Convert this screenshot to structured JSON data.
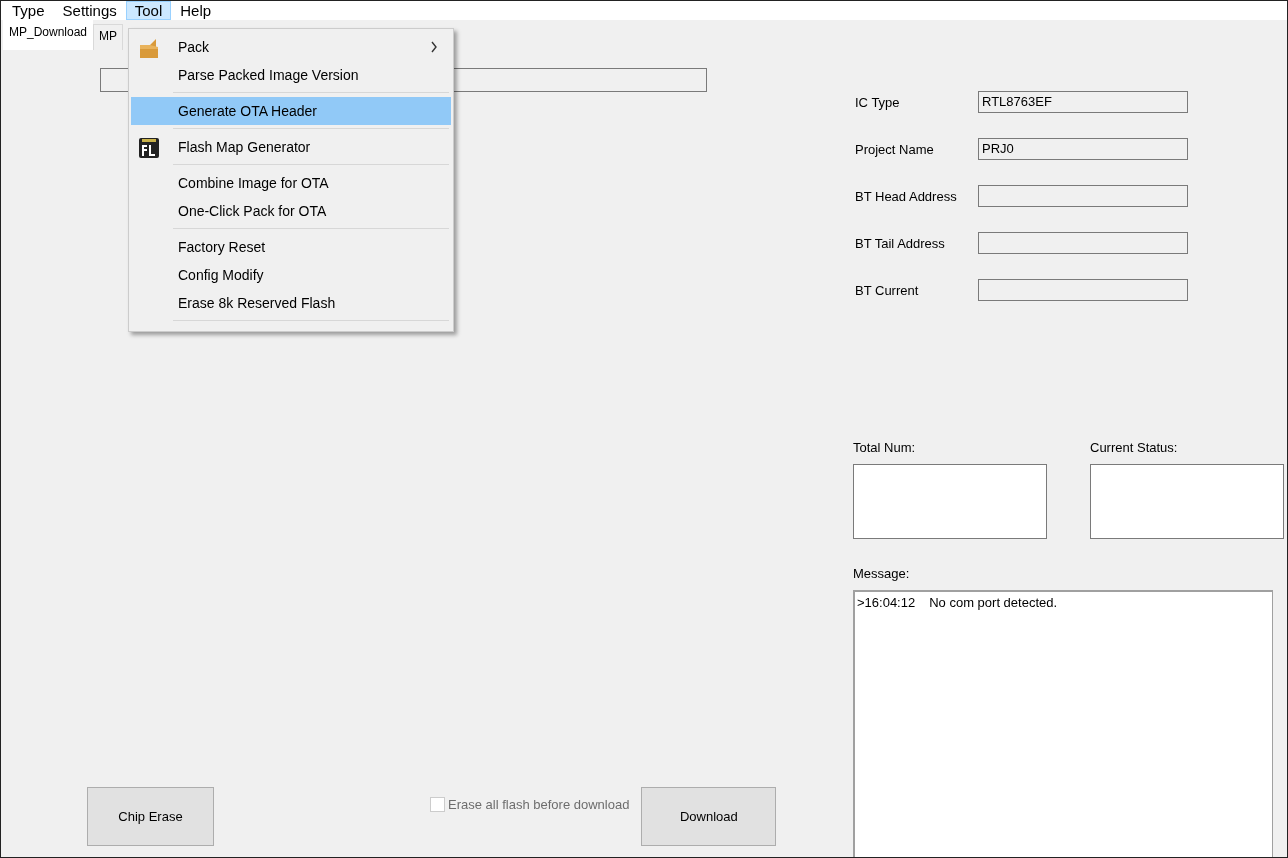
{
  "menu_bar": [
    {
      "label": "Type",
      "selected": false
    },
    {
      "label": "Settings",
      "selected": false
    },
    {
      "label": "Tool",
      "selected": true
    },
    {
      "label": "Help",
      "selected": false
    }
  ],
  "tool_menu": {
    "groups": [
      [
        {
          "label": "Pack",
          "submenu": true,
          "selected": false
        },
        {
          "label": "Parse Packed Image Version",
          "submenu": false,
          "selected": false
        }
      ],
      [
        {
          "label": "Generate OTA Header",
          "submenu": false,
          "selected": true
        }
      ],
      [
        {
          "label": "Flash Map Generator",
          "submenu": false,
          "selected": false
        }
      ],
      [
        {
          "label": "Combine Image for OTA",
          "submenu": false,
          "selected": false
        },
        {
          "label": "One-Click Pack for OTA",
          "submenu": false,
          "selected": false
        }
      ],
      [
        {
          "label": "Factory Reset",
          "submenu": false,
          "selected": false
        },
        {
          "label": "Config Modify",
          "submenu": false,
          "selected": false
        },
        {
          "label": "Erase 8k Reserved Flash",
          "submenu": false,
          "selected": false
        }
      ]
    ]
  },
  "tabs": [
    {
      "label": "MP_Download",
      "selected": true
    },
    {
      "label": "MP",
      "selected": false
    }
  ],
  "info_fields": [
    {
      "label": "IC Type",
      "value": "RTL8763EF"
    },
    {
      "label": "Project Name",
      "value": "PRJ0"
    },
    {
      "label": "BT Head Address"
    },
    {
      "label": "BT Tail Address"
    },
    {
      "label": "BT Current"
    }
  ],
  "total_num": {
    "label": "Total Num:"
  },
  "current_status": {
    "label": "Current Status:"
  },
  "message": {
    "label": "Message:",
    "lines": [
      {
        "time": ">16:04:12",
        "text": "No com port detected."
      }
    ]
  },
  "chip_erase_button": "Chip Erase",
  "erase_all_checkbox": {
    "label": "Erase all flash before download",
    "checked": false,
    "disabled": true
  },
  "download_button": "Download"
}
